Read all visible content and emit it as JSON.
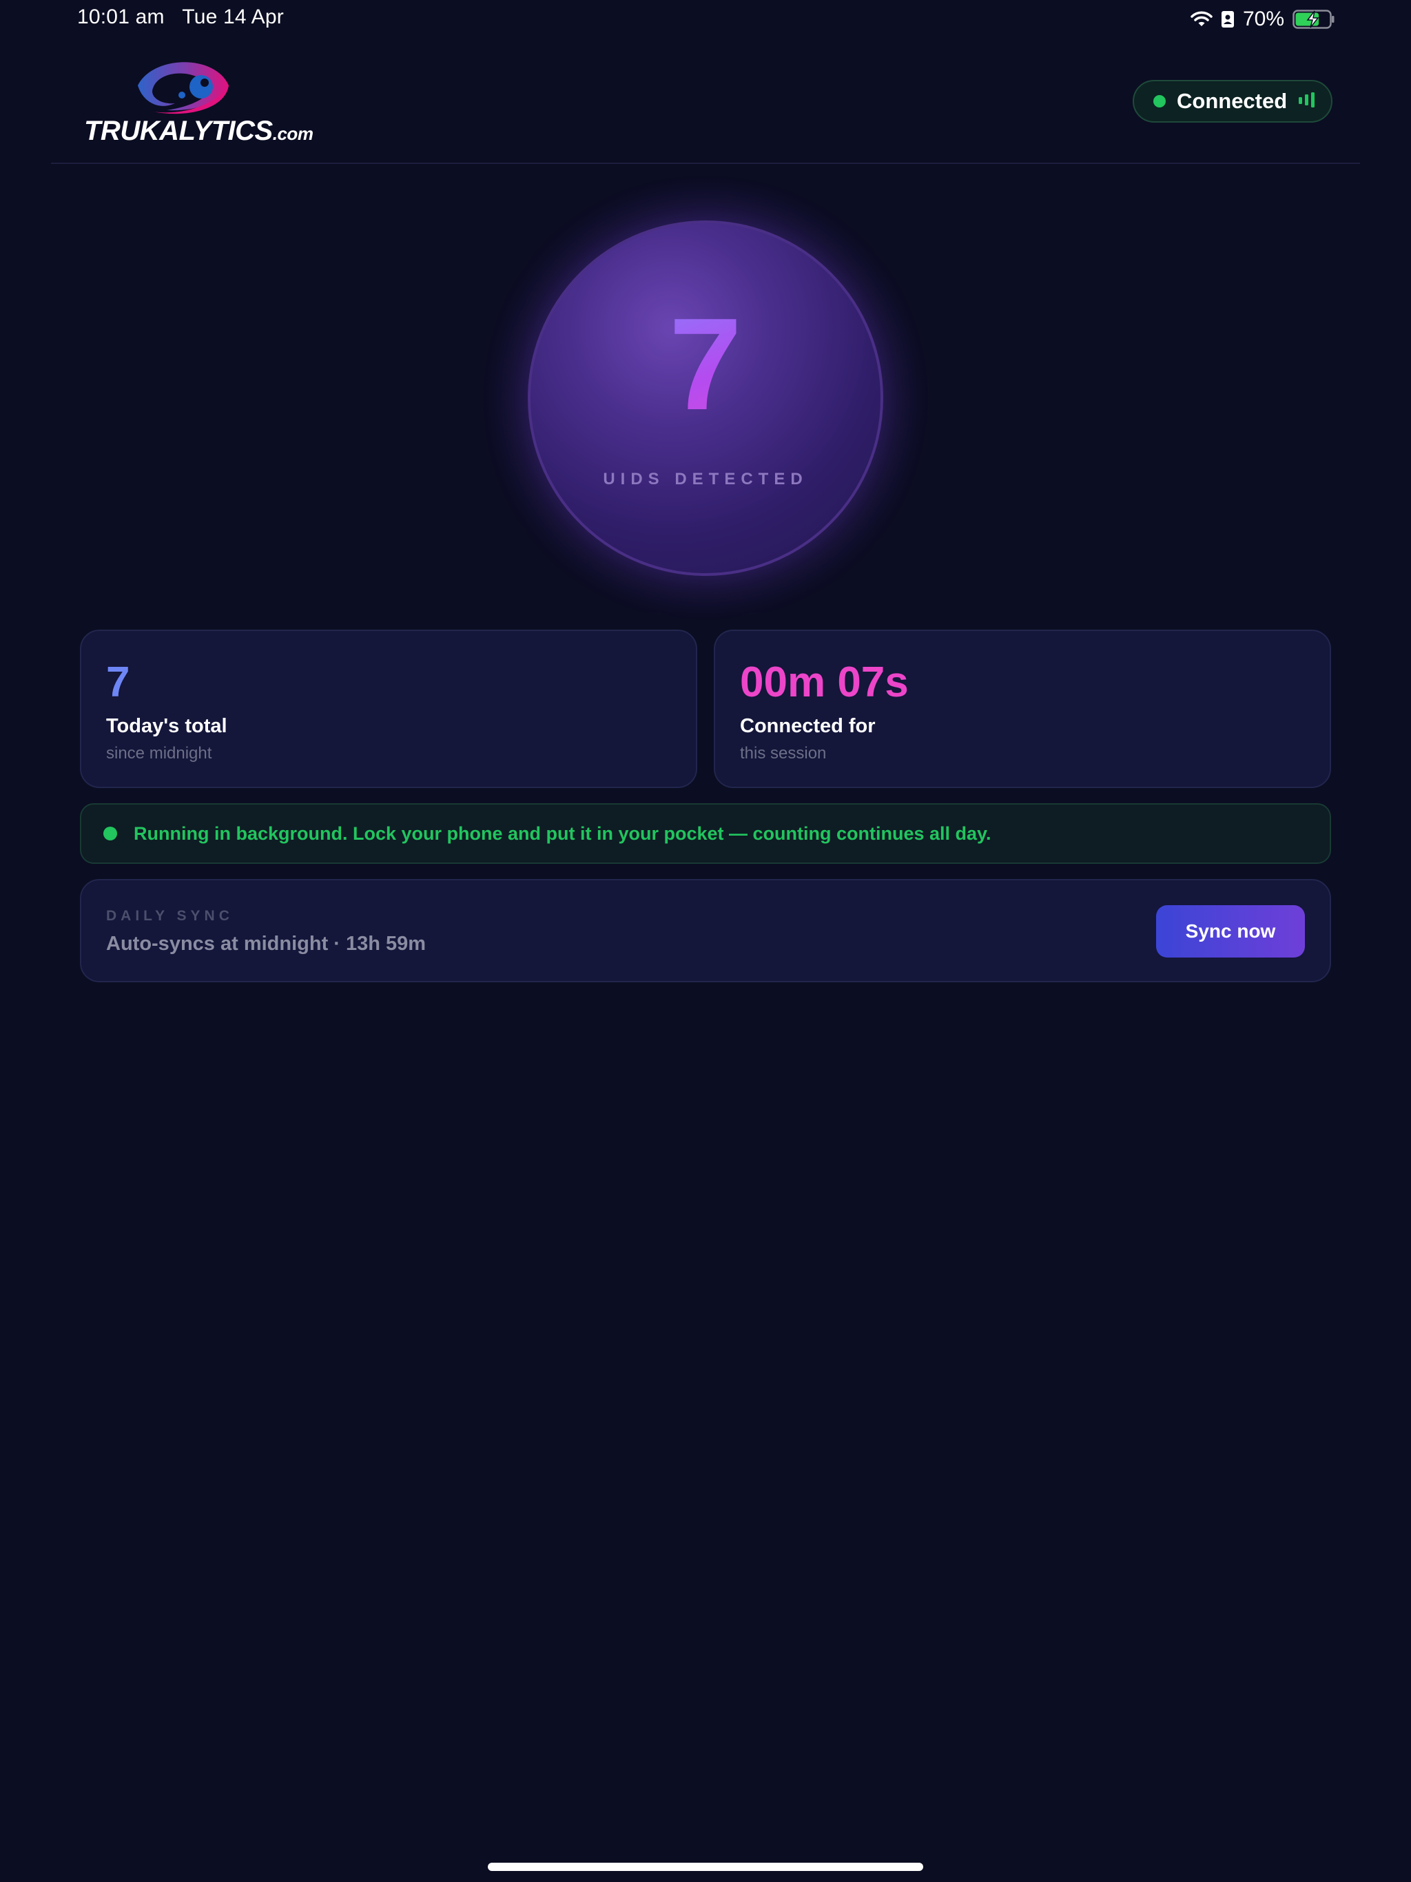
{
  "status_bar": {
    "time": "10:01 am",
    "date": "Tue 14 Apr",
    "battery": "70%",
    "battery_level": 0.7,
    "icons": [
      "wifi-icon",
      "sim-icon",
      "battery-charging-icon"
    ]
  },
  "header": {
    "logo_text": "TRUKALYTICS",
    "logo_suffix": ".com",
    "connection_status": "Connected",
    "icons": [
      "signal-bars-icon"
    ]
  },
  "counter": {
    "value": "7",
    "label": "UIDS DETECTED"
  },
  "stats": {
    "total": {
      "value": "7",
      "title": "Today's total",
      "subtitle": "since midnight"
    },
    "connected": {
      "value": "00m 07s",
      "title": "Connected for",
      "subtitle": "this session"
    }
  },
  "banner": {
    "text": "Running in background. Lock your phone and put it in your pocket — counting continues all day."
  },
  "sync": {
    "label": "DAILY SYNC",
    "description": "Auto-syncs at midnight · 13h 59m",
    "button_label": "Sync now"
  },
  "colors": {
    "background": "#0b0d22",
    "card": "#14163a",
    "accent_green": "#22c55e",
    "accent_blue": "#6e86f5",
    "accent_pink": "#ec45c9",
    "accent_purple": "#6e3fd8"
  }
}
